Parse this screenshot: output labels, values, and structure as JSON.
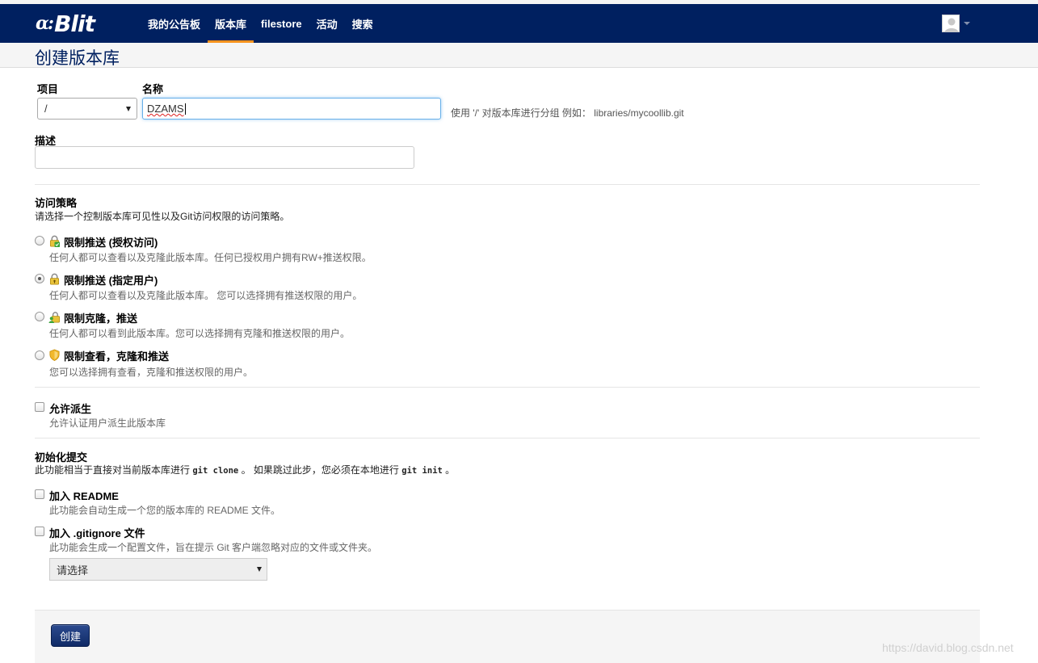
{
  "brand": {
    "mark": "ɑ:",
    "name": "Blit"
  },
  "nav": {
    "items": [
      {
        "label": "我的公告板",
        "active": false
      },
      {
        "label": "版本库",
        "active": true
      },
      {
        "label": "filestore",
        "active": false
      },
      {
        "label": "活动",
        "active": false
      },
      {
        "label": "搜索",
        "active": false
      }
    ]
  },
  "header": {
    "title": "创建版本库"
  },
  "form": {
    "project_label": "项目",
    "project_value": "/",
    "name_label": "名称",
    "name_value": "DZAMS",
    "name_hint": "使用 '/' 对版本库进行分组 例如： libraries/mycoollib.git",
    "description_label": "描述",
    "description_value": ""
  },
  "access": {
    "title": "访问策略",
    "description": "请选择一个控制版本库可见性以及Git访问权限的访问策略。",
    "options": [
      {
        "label": "限制推送 (授权访问)",
        "desc": "任何人都可以查看以及克隆此版本库。任何已授权用户拥有RW+推送权限。",
        "checked": false,
        "icon": "lock-green-icon"
      },
      {
        "label": "限制推送 (指定用户)",
        "desc": "任何人都可以查看以及克隆此版本库。 您可以选择拥有推送权限的用户。",
        "checked": true,
        "icon": "lock-yellow-icon"
      },
      {
        "label": "限制克隆，推送",
        "desc": "任何人都可以看到此版本库。您可以选择拥有克隆和推送权限的用户。",
        "checked": false,
        "icon": "lock-user-icon"
      },
      {
        "label": "限制查看，克隆和推送",
        "desc": "您可以选择拥有查看，克隆和推送权限的用户。",
        "checked": false,
        "icon": "shield-icon"
      }
    ]
  },
  "fork": {
    "label": "允许派生",
    "desc": "允许认证用户派生此版本库"
  },
  "init": {
    "title": "初始化提交",
    "desc_1": "此功能相当于直接对当前版本库进行 ",
    "code_1": "git clone",
    "desc_2": " 。 如果跳过此步，您必须在本地进行 ",
    "code_2": "git init",
    "desc_3": " 。",
    "readme_label": "加入 README",
    "readme_desc": "此功能会自动生成一个您的版本库的 README 文件。",
    "gitignore_label": "加入 .gitignore 文件",
    "gitignore_desc": "此功能会生成一个配置文件，旨在提示 Git 客户端忽略对应的文件或文件夹。",
    "gitignore_select": "请选择"
  },
  "actions": {
    "create_label": "创建"
  },
  "watermark": "https://david.blog.csdn.net",
  "colors": {
    "navbar": "#002060",
    "accent": "#f7931e",
    "button": "#1a3a7a"
  }
}
